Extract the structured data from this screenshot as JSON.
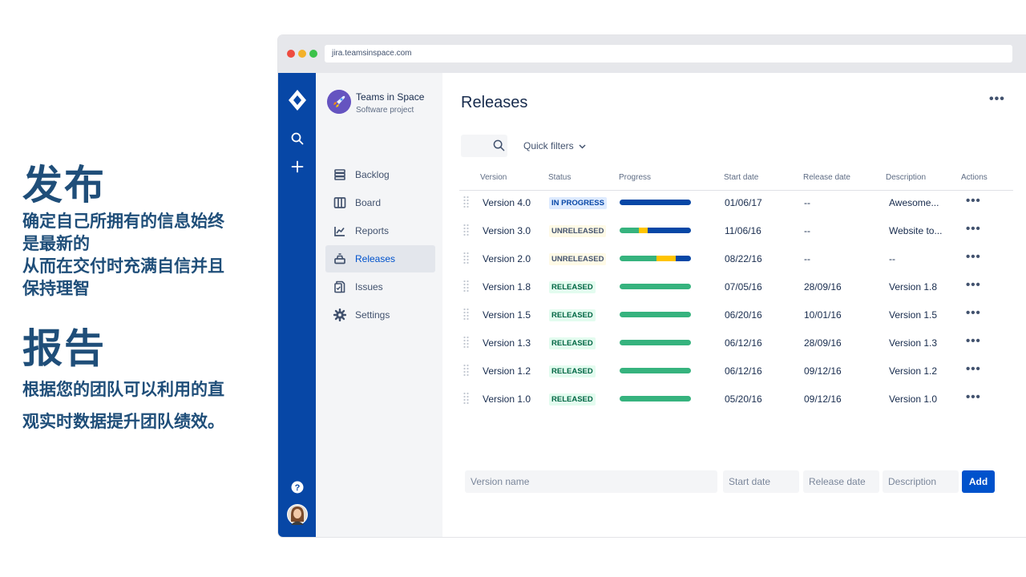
{
  "slide": {
    "heading1": "发布",
    "body1_lines": [
      "确定自己所拥有的信息始终",
      "是最新的",
      "从而在交付时充满自信并且",
      "保持理智"
    ],
    "heading2": "报告",
    "body2_lines": [
      "根据您的团队可以利用的直",
      "观实时数据提升团队绩效。"
    ]
  },
  "browser": {
    "url": "jira.teamsinspace.com"
  },
  "rail": {
    "icons": [
      "jira-logo-icon",
      "search-icon",
      "plus-icon",
      "help-icon",
      "user-avatar"
    ]
  },
  "project": {
    "name": "Teams in Space",
    "type": "Software project"
  },
  "nav": [
    {
      "label": "Backlog",
      "icon": "backlog-icon"
    },
    {
      "label": "Board",
      "icon": "board-icon"
    },
    {
      "label": "Reports",
      "icon": "reports-icon"
    },
    {
      "label": "Releases",
      "icon": "releases-icon",
      "active": true
    },
    {
      "label": "Issues",
      "icon": "issues-icon"
    },
    {
      "label": "Settings",
      "icon": "settings-icon"
    }
  ],
  "page": {
    "title": "Releases",
    "quick_filters": "Quick filters"
  },
  "table": {
    "headers": {
      "version": "Version",
      "status": "Status",
      "progress": "Progress",
      "start": "Start date",
      "release": "Release date",
      "description": "Description",
      "actions": "Actions"
    },
    "rows": [
      {
        "version": "Version 4.0",
        "status": "IN PROGRESS",
        "status_type": "inprogress",
        "progress": [
          {
            "color": "#0747a6",
            "fraction": 1.0
          }
        ],
        "start": "01/06/17",
        "release": "--",
        "description": "Awesome..."
      },
      {
        "version": "Version 3.0",
        "status": "UNRELEASED",
        "status_type": "unreleased",
        "progress": [
          {
            "color": "#36b37e",
            "fraction": 0.27
          },
          {
            "color": "#ffc400",
            "fraction": 0.12
          },
          {
            "color": "#0747a6",
            "fraction": 0.61
          }
        ],
        "start": "11/06/16",
        "release": "--",
        "description": "Website to..."
      },
      {
        "version": "Version 2.0",
        "status": "UNRELEASED",
        "status_type": "unreleased",
        "progress": [
          {
            "color": "#36b37e",
            "fraction": 0.52
          },
          {
            "color": "#ffc400",
            "fraction": 0.27
          },
          {
            "color": "#0747a6",
            "fraction": 0.21
          }
        ],
        "start": "08/22/16",
        "release": "--",
        "description": "--"
      },
      {
        "version": "Version 1.8",
        "status": "RELEASED",
        "status_type": "released",
        "progress": [
          {
            "color": "#36b37e",
            "fraction": 1.0
          }
        ],
        "start": "07/05/16",
        "release": "28/09/16",
        "description": "Version 1.8"
      },
      {
        "version": "Version 1.5",
        "status": "RELEASED",
        "status_type": "released",
        "progress": [
          {
            "color": "#36b37e",
            "fraction": 1.0
          }
        ],
        "start": "06/20/16",
        "release": "10/01/16",
        "description": "Version 1.5"
      },
      {
        "version": "Version 1.3",
        "status": "RELEASED",
        "status_type": "released",
        "progress": [
          {
            "color": "#36b37e",
            "fraction": 1.0
          }
        ],
        "start": "06/12/16",
        "release": "28/09/16",
        "description": "Version 1.3"
      },
      {
        "version": "Version 1.2",
        "status": "RELEASED",
        "status_type": "released",
        "progress": [
          {
            "color": "#36b37e",
            "fraction": 1.0
          }
        ],
        "start": "06/12/16",
        "release": "09/12/16",
        "description": "Version 1.2"
      },
      {
        "version": "Version 1.0",
        "status": "RELEASED",
        "status_type": "released",
        "progress": [
          {
            "color": "#36b37e",
            "fraction": 1.0
          }
        ],
        "start": "05/20/16",
        "release": "09/12/16",
        "description": "Version 1.0"
      }
    ]
  },
  "form": {
    "version_placeholder": "Version name",
    "start_placeholder": "Start date",
    "release_placeholder": "Release date",
    "description_placeholder": "Description",
    "add_label": "Add"
  },
  "colors": {
    "nav_rail": "#0747a6",
    "primary_button": "#0052cc",
    "slide_text": "#1f4e79"
  }
}
